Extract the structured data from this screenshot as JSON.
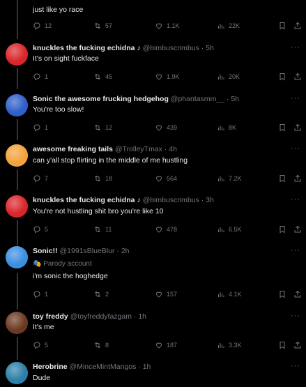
{
  "tweets": [
    {
      "text": "just like yo race",
      "stats": {
        "replies": "12",
        "reposts": "57",
        "likes": "1.1K",
        "views": "22K"
      }
    },
    {
      "name": "knuckles the fucking echidna",
      "name_suffix": "♪",
      "handle": "@bimbuscrimbus",
      "time": "5h",
      "text": "It's on sight fuckface",
      "avatar_color": "#d9262b",
      "stats": {
        "replies": "1",
        "reposts": "45",
        "likes": "1.9K",
        "views": "20K"
      }
    },
    {
      "name": "Sonic the awesome frucking hedgehog",
      "handle": "@phantasmm__",
      "time": "5h",
      "text": "You're too slow!",
      "avatar_color": "#2f5fc8",
      "stats": {
        "replies": "1",
        "reposts": "12",
        "likes": "439",
        "views": "8K"
      }
    },
    {
      "name": "awesome freaking tails",
      "handle": "@TrolleyTmax",
      "time": "4h",
      "text": "can y'all stop flirting in the middle of me hustling",
      "avatar_color": "#f2a23a",
      "stats": {
        "replies": "7",
        "reposts": "18",
        "likes": "564",
        "views": "7.2K"
      }
    },
    {
      "name": "knuckles the fucking echidna",
      "name_suffix": "♪",
      "handle": "@bimbuscrimbus",
      "time": "3h",
      "text": "You're not hustling shit bro you're like 10",
      "avatar_color": "#d9262b",
      "stats": {
        "replies": "5",
        "reposts": "11",
        "likes": "478",
        "views": "6.5K"
      }
    },
    {
      "name": "Sonic!!",
      "handle": "@1991sBlueBlur",
      "time": "2h",
      "label": "Parody account",
      "text": "i'm sonic the hoghedge",
      "avatar_color": "#3b8fe0",
      "stats": {
        "replies": "1",
        "reposts": "2",
        "likes": "157",
        "views": "4.1K"
      }
    },
    {
      "name": "toy freddy",
      "handle": "@toyfreddyfazgam",
      "time": "1h",
      "text": "It's me",
      "avatar_color": "#6b3a22",
      "stats": {
        "replies": "5",
        "reposts": "8",
        "likes": "187",
        "views": "3.3K"
      }
    },
    {
      "name": "Herobrine",
      "handle": "@MinceMintMangos",
      "time": "1h",
      "text": "Dude",
      "avatar_color": "#2c7fa8"
    }
  ]
}
